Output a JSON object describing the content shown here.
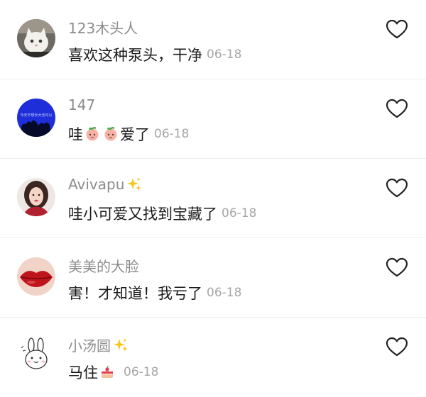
{
  "comments": [
    {
      "username": "123木头人",
      "text": "喜欢这种泵头，干净",
      "date": "06-18",
      "avatar": "white-cat-photo",
      "badge": null
    },
    {
      "username": "147",
      "text_before": "哇",
      "emoji": "peach-emoji",
      "text_after": "爱了",
      "date": "06-18",
      "avatar": "blue-silhouette-avatar",
      "avatar_text": "今天不想长大也可以",
      "badge": null
    },
    {
      "username": "Avivapu",
      "text": "哇小可爱又找到宝藏了",
      "date": "06-18",
      "avatar": "woman-portrait-photo",
      "badge": "sparkle-icon"
    },
    {
      "username": "美美的大脸",
      "text": "害！才知道！我亏了",
      "date": "06-18",
      "avatar": "red-lips-photo",
      "badge": null
    },
    {
      "username": "小汤圆",
      "text_before": "马住",
      "emoji": "cake-emoji",
      "date": "06-18",
      "avatar": "cartoon-rabbit-avatar",
      "badge": "sparkle-icon"
    }
  ],
  "colors": {
    "username": "#8c8c8c",
    "text": "#1a1a1a",
    "date": "#a6a6a6",
    "like_icon": "#222222"
  }
}
